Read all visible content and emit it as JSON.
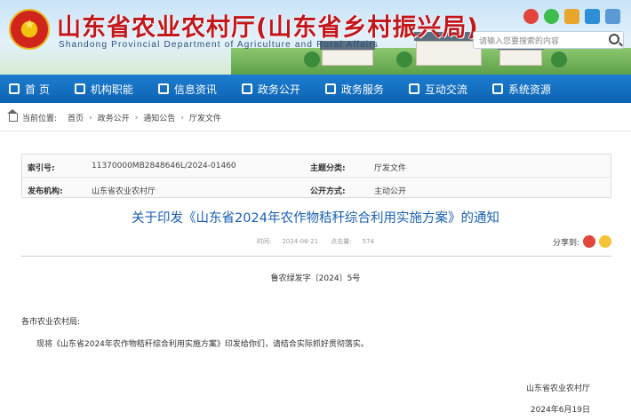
{
  "header": {
    "site_title": "山东省农业农村厅(山东省乡村振兴局)",
    "site_subtitle": "Shandong Provincial Department of Agriculture and Rural Affairs",
    "search_placeholder": "请输入您要搜索的内容",
    "share_icons": [
      "weibo-icon",
      "wechat-icon",
      "mail-icon",
      "accessibility-icon",
      "settings-icon"
    ]
  },
  "nav": {
    "items": [
      "首 页",
      "机构职能",
      "信息资讯",
      "政务公开",
      "政务服务",
      "互动交流",
      "系统资源"
    ]
  },
  "breadcrumb": {
    "label": "当前位置:",
    "items": [
      "首页",
      "政务公开",
      "通知公告",
      "厅发文件"
    ]
  },
  "meta": {
    "index_label": "索引号:",
    "index_value": "11370000MB2848646L/2024-01460",
    "subject_label": "主题分类:",
    "subject_value": "厅发文件",
    "issuer_label": "发布机构:",
    "issuer_value": "山东省农业农村厅",
    "public_label": "公开方式:",
    "public_value": "主动公开"
  },
  "document": {
    "title": "关于印发《山东省2024年农作物秸秆综合利用实施方案》的通知",
    "date_label": "时间:",
    "date_value": "2024-06-21",
    "views_label": "点击量:",
    "views_value": "574",
    "share_label": "分享到:",
    "doc_number": "鲁农绿发字〔2024〕5号",
    "recipient": "各市农业农村局:",
    "body": "现将《山东省2024年农作物秸秆综合利用实施方案》印发给你们，请结合实际抓好贯彻落实。",
    "signature": "山东省农业农村厅",
    "sign_date": "2024年6月19日"
  },
  "colors": {
    "nav_bg": "#0d63b3",
    "title_red": "#c2161b",
    "doc_title_blue": "#1a5fb4"
  }
}
